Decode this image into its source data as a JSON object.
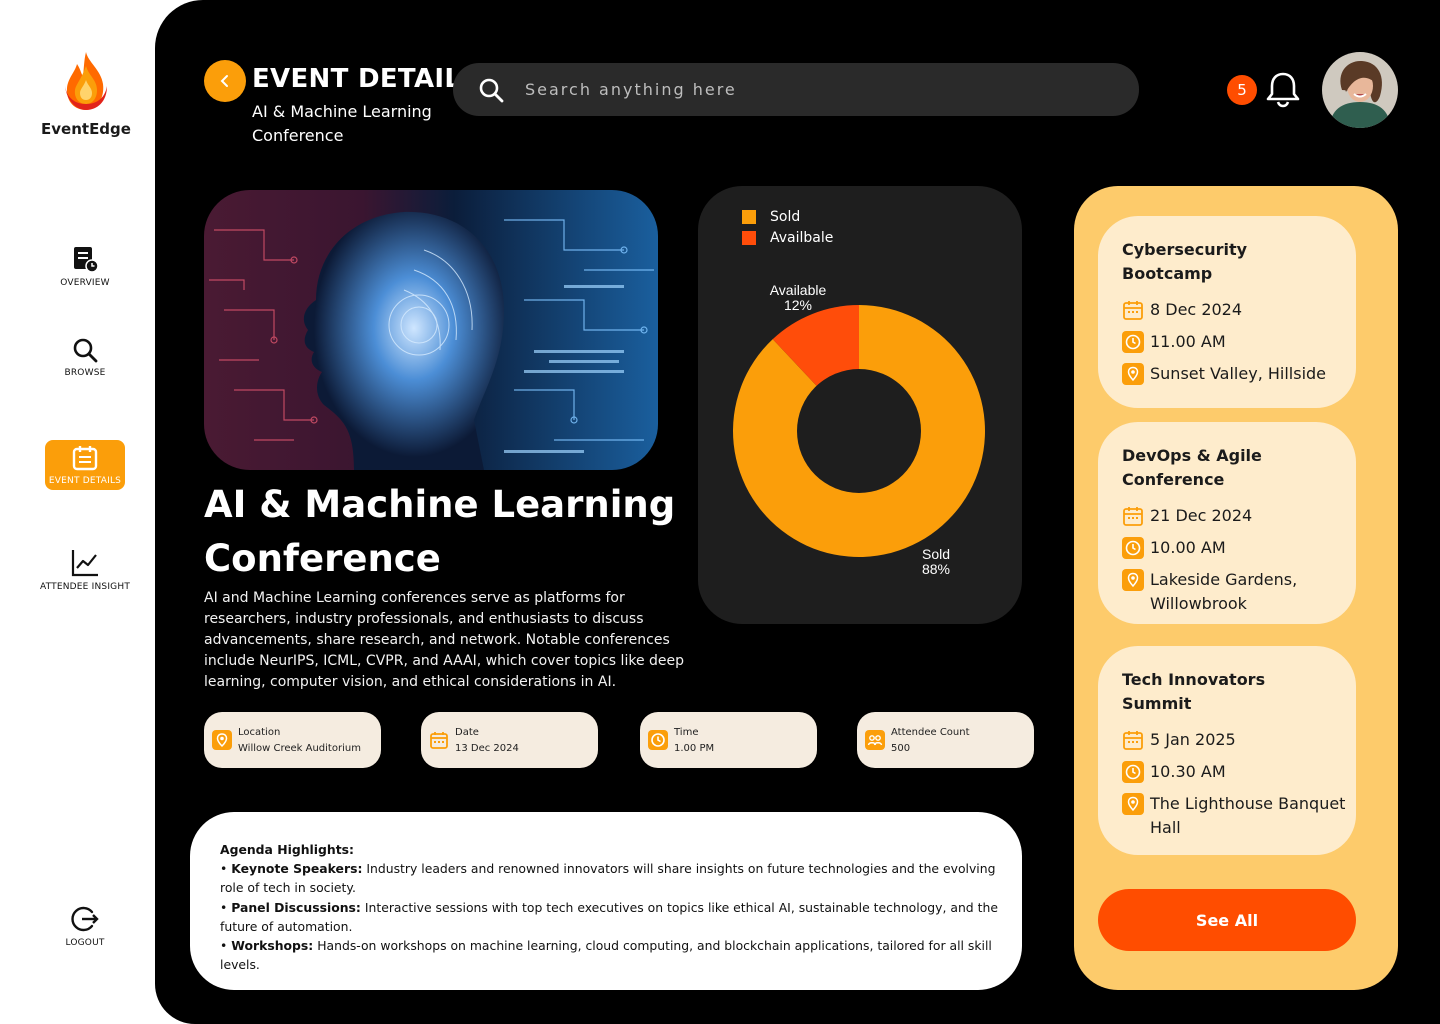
{
  "brand": {
    "name": "EventEdge"
  },
  "sidebar": {
    "items": [
      {
        "label": "OVERVIEW",
        "icon": "overview-icon"
      },
      {
        "label": "BROWSE",
        "icon": "search-icon"
      },
      {
        "label": "EVENT DETAILS",
        "icon": "calendar-icon",
        "active": true
      },
      {
        "label": "ATTENDEE INSIGHT",
        "icon": "line-chart-icon"
      }
    ],
    "logout": "LOGOUT"
  },
  "header": {
    "title": "EVENT DETAILS",
    "subtitle": "AI & Machine Learning Conference",
    "search_placeholder": "Search anything here",
    "notification_count": "5"
  },
  "event": {
    "title": "AI & Machine Learning Conference",
    "description": "AI and Machine Learning conferences serve as platforms for researchers, industry professionals, and enthusiasts to discuss advancements, share research, and network. Notable conferences include NeurIPS, ICML, CVPR, and AAAI, which cover topics like deep learning, computer vision, and ethical considerations in AI.",
    "details": [
      {
        "label": "Location",
        "value": "Willow Creek Auditorium",
        "icon": "location-pin-icon"
      },
      {
        "label": "Date",
        "value": "13 Dec 2024",
        "icon": "calendar-icon"
      },
      {
        "label": "Time",
        "value": "1.00 PM",
        "icon": "clock-icon"
      },
      {
        "label": "Attendee Count",
        "value": "500",
        "icon": "people-icon"
      }
    ]
  },
  "chart_data": {
    "type": "pie",
    "style": "donut",
    "legend": [
      "Sold",
      "Availbale"
    ],
    "slices": [
      {
        "label": "Sold",
        "value": 88,
        "display": "88%",
        "color": "#fb9e0a"
      },
      {
        "label": "Available",
        "value": 12,
        "display": "12%",
        "color": "#ff4d0a"
      }
    ],
    "legend_position": "top-left"
  },
  "agenda": {
    "heading": "Agenda Highlights:",
    "items": [
      {
        "title": "Keynote Speakers:",
        "text": " Industry leaders and renowned innovators will share insights on future technologies and the evolving role of tech in society."
      },
      {
        "title": "Panel Discussions:",
        "text": " Interactive sessions with top tech executives on topics like ethical AI, sustainable technology, and the future of automation."
      },
      {
        "title": "Workshops:",
        "text": " Hands-on workshops on machine learning, cloud computing, and blockchain applications, tailored for all skill levels."
      }
    ]
  },
  "upcoming": {
    "events": [
      {
        "title": "Cybersecurity Bootcamp",
        "date": "8 Dec 2024",
        "time": "11.00 AM",
        "location": "Sunset Valley, Hillside"
      },
      {
        "title": "DevOps & Agile Conference",
        "date": "21 Dec 2024",
        "time": "10.00 AM",
        "location": "Lakeside Gardens, Willowbrook"
      },
      {
        "title": "Tech Innovators Summit",
        "date": "5 Jan 2025",
        "time": "10.30 AM",
        "location": "The Lighthouse Banquet Hall"
      }
    ],
    "see_all": "See All"
  },
  "colors": {
    "accent": "#fb9e0a",
    "danger": "#ff4d00",
    "panel_yellow": "#fdcb6b",
    "card_cream": "#feeccc"
  }
}
